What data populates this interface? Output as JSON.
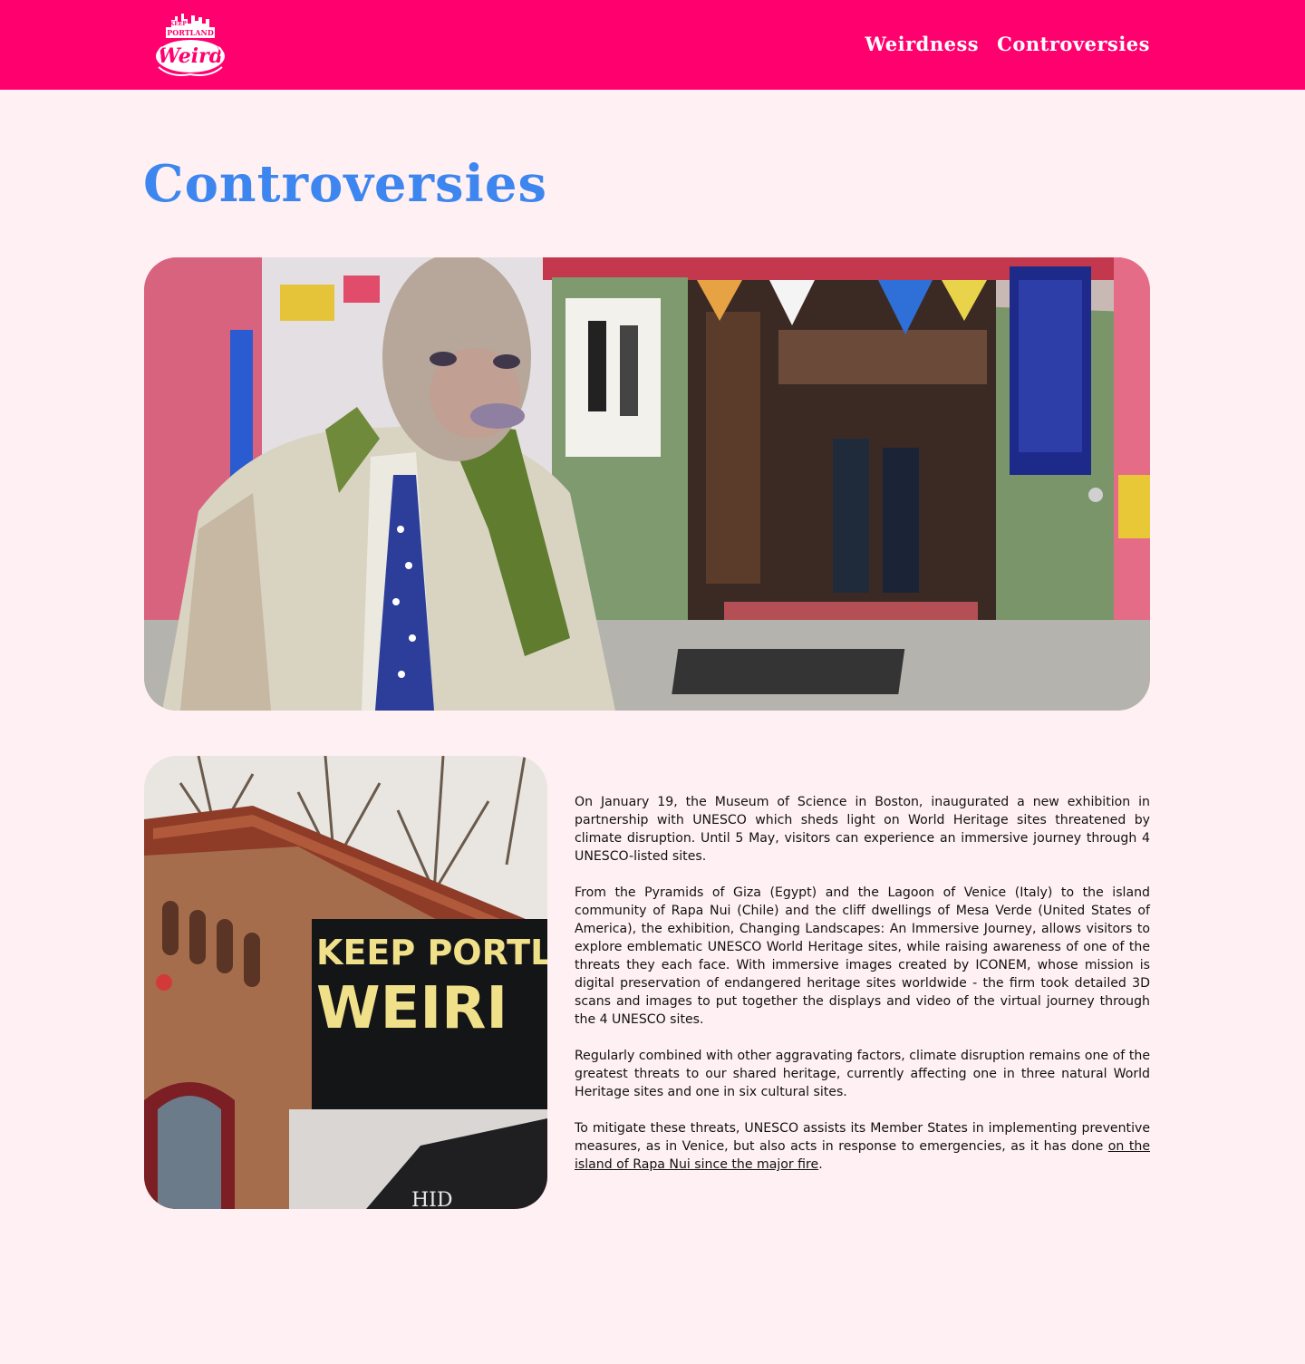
{
  "header": {
    "logo_alt": "Keep Portland Weird logo",
    "logo_text": {
      "top": "KEEP",
      "middle": "PORTLAND",
      "script": "Weird"
    },
    "nav": [
      {
        "label": "Weirdness"
      },
      {
        "label": "Controversies"
      }
    ],
    "bg_color": "#ff006e"
  },
  "page": {
    "title": "Controversies",
    "title_color": "#3d86f0",
    "bg_color": "#fff0f3"
  },
  "images": {
    "hero_alt": "Costumed figure outside a shop entrance in Portland",
    "side_alt": "Brick building with Keep Portland Weird sign",
    "side_sign_line1": "KEEP PORTLA",
    "side_sign_line2": "WEIRI",
    "side_awning_text": "HID"
  },
  "article": {
    "p1": "On January 19, the Museum of Science in Boston, inaugurated a new exhibition in partnership with UNESCO which sheds light on World Heritage sites threatened by climate disruption. Until 5 May, visitors can experience an immersive journey through 4 UNESCO-listed sites.",
    "p2": "From the Pyramids of Giza (Egypt) and the Lagoon of Venice (Italy) to the island community of Rapa Nui (Chile) and the cliff dwellings of Mesa Verde (United States of America), the exhibition, Changing Landscapes: An Immersive Journey, allows visitors to explore emblematic UNESCO World Heritage sites, while raising awareness of one of the threats they each face. With immersive images created by ICONEM, whose mission is digital preservation of endangered heritage sites worldwide - the firm took detailed 3D scans and images to put together the displays and video of the virtual journey through the 4 UNESCO sites.",
    "p3": "Regularly combined with other aggravating factors, climate disruption remains one of the greatest threats to our shared heritage, currently affecting one in three natural World Heritage sites and one in six cultural sites.",
    "p4_before": "To mitigate these threats, UNESCO assists its Member States in implementing preventive measures, as in Venice, but also acts in response to emergencies, as it has done ",
    "p4_link": "on the island of Rapa Nui since the major fire",
    "p4_after": "."
  }
}
